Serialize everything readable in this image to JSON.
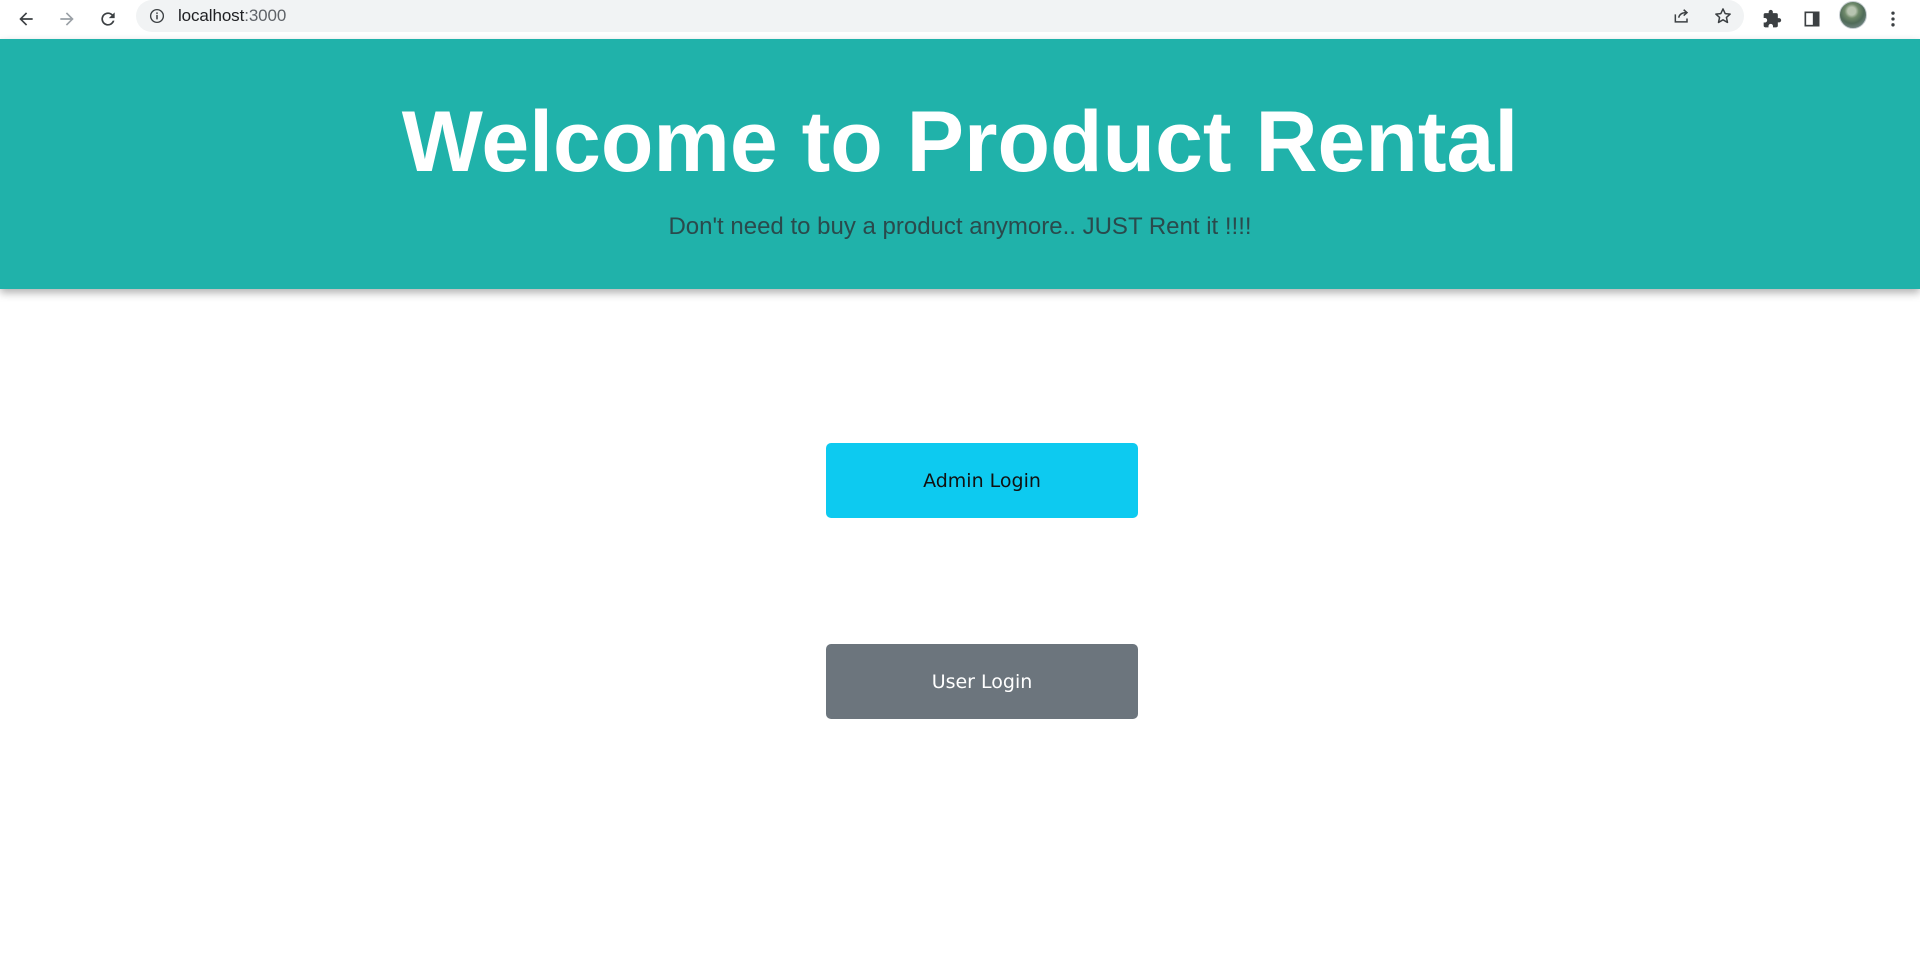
{
  "browser": {
    "url_host": "localhost",
    "url_port": ":3000",
    "icons": {
      "back": "back-arrow-icon",
      "forward": "forward-arrow-icon",
      "reload": "reload-icon",
      "site_info": "info-icon",
      "share": "share-icon",
      "bookmark": "star-icon",
      "extensions": "puzzle-icon",
      "side_panel": "side-panel-icon",
      "profile": "avatar",
      "menu": "kebab-menu-icon"
    }
  },
  "hero": {
    "title": "Welcome to Product Rental",
    "subtitle": "Don't need to buy a product anymore.. JUST Rent it !!!!",
    "background_color": "#20b2aa"
  },
  "actions": {
    "admin_login_label": "Admin Login",
    "user_login_label": "User Login",
    "admin_color": "#0dcaf0",
    "user_color": "#6c757d"
  }
}
